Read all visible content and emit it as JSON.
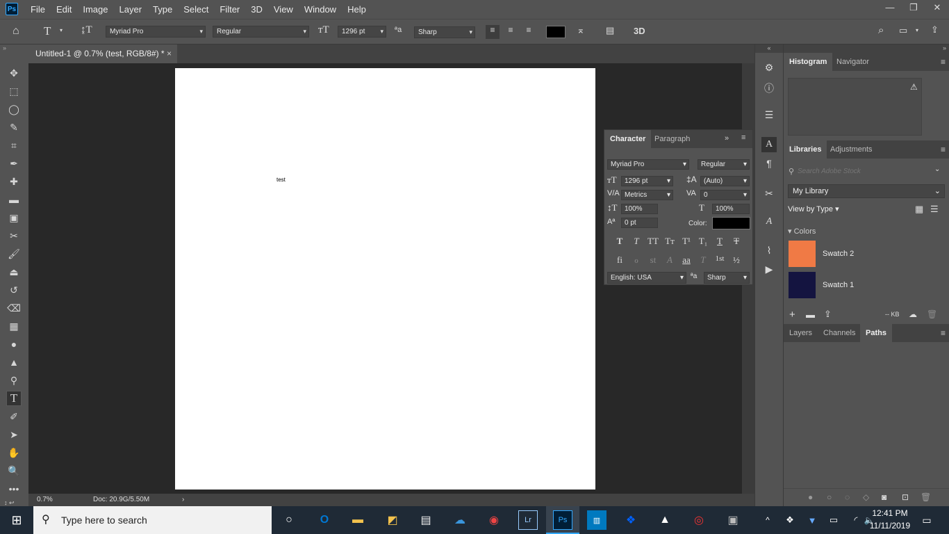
{
  "menubar": {
    "app_logo": "Ps",
    "items": [
      "File",
      "Edit",
      "Image",
      "Layer",
      "Type",
      "Select",
      "Filter",
      "3D",
      "View",
      "Window",
      "Help"
    ],
    "win_min": "—",
    "win_max": "❐",
    "win_close": "✕"
  },
  "options": {
    "font_family": "Myriad Pro",
    "font_style": "Regular",
    "font_size": "1296 pt",
    "antialias": "Sharp",
    "text_color": "#000000",
    "3d_label": "3D"
  },
  "document": {
    "tab_title": "Untitled-1 @ 0.7% (test, RGB/8#) *",
    "tab_close": "×",
    "canvas_text": "test",
    "zoom": "0.7%",
    "doc_info": "Doc: 20.9G/5.50M",
    "status_arrow": "›"
  },
  "character_panel": {
    "tabs": [
      "Character",
      "Paragraph"
    ],
    "font_family": "Myriad Pro",
    "font_style": "Regular",
    "font_size": "1296 pt",
    "leading": "(Auto)",
    "kerning": "Metrics",
    "tracking": "0",
    "vscale": "100%",
    "hscale": "100%",
    "baseline": "0 pt",
    "color_label": "Color:",
    "color": "#000000",
    "language": "English: USA",
    "antialias": "Sharp",
    "glyphs_row1": [
      "T",
      "T",
      "TT",
      "Tт",
      "T¹",
      "T₁",
      "T",
      "T"
    ],
    "glyphs_row2": [
      "fi",
      "ℴ",
      "st",
      "A",
      "aa",
      "T",
      "1st",
      "½"
    ]
  },
  "top_panel": {
    "tabs": [
      "Histogram",
      "Navigator"
    ],
    "warning": "⚠"
  },
  "libraries": {
    "tabs": [
      "Libraries",
      "Adjustments"
    ],
    "search_placeholder": "Search Adobe Stock",
    "library": "My Library",
    "view_by": "View by Type",
    "colors_label": "Colors",
    "swatches": [
      {
        "name": "Swatch 2",
        "color": "#f07a45"
      },
      {
        "name": "Swatch 1",
        "color": "#141440"
      }
    ],
    "kb": "-- KB"
  },
  "layers_panel": {
    "tabs": [
      "Layers",
      "Channels",
      "Paths"
    ]
  },
  "taskbar": {
    "search_placeholder": "Type here to search",
    "time": "12:41 PM",
    "date": "11/11/2019"
  }
}
